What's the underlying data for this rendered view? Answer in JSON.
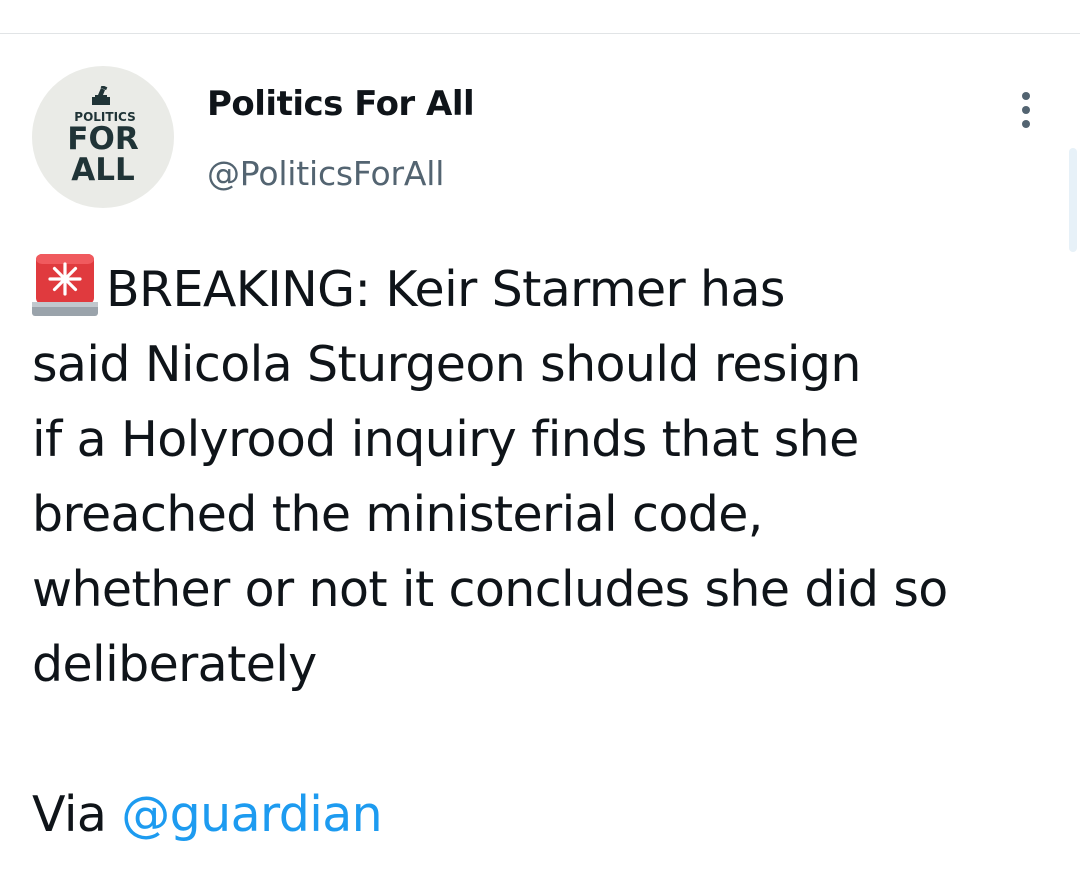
{
  "tweet": {
    "author": {
      "display_name": "Politics For All",
      "handle": "@PoliticsForAll",
      "avatar": {
        "line1": "POLITICS",
        "line2": "FOR",
        "line3": "ALL",
        "icon": "ballot-box-icon",
        "background": "#eaebe7",
        "text_color": "#203437"
      }
    },
    "more_icon": "more-options-icon",
    "siren_icon": "police-car-light-icon",
    "lines": [
      "BREAKING: Keir Starmer has",
      "said Nicola Sturgeon should resign",
      "if a Holyrood inquiry finds that she",
      "breached the ministerial code,",
      "whether or not it concludes she did so",
      "deliberately"
    ],
    "via_prefix": "Via ",
    "mention": "@guardian"
  },
  "colors": {
    "text": "#0f1419",
    "secondary": "#536471",
    "link": "#1d9bf0",
    "divider": "#e1e4e6",
    "siren_red": "#e03a3e"
  }
}
